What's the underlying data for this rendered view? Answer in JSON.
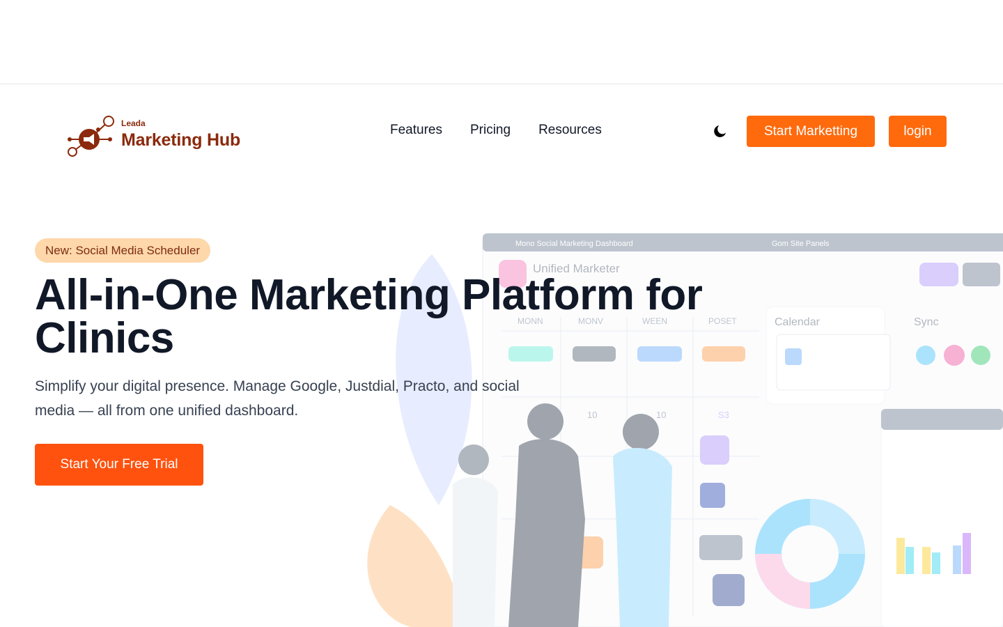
{
  "brand": {
    "small_label": "Leada",
    "name": "Marketing Hub",
    "color": "#8b2a0c"
  },
  "nav": {
    "items": [
      {
        "label": "Features"
      },
      {
        "label": "Pricing"
      },
      {
        "label": "Resources"
      }
    ]
  },
  "header_actions": {
    "theme_icon": "moon-icon",
    "start_label": "Start Marketting",
    "login_label": "login",
    "accent_color": "#ff6a0d"
  },
  "hero": {
    "badge": "New: Social Media Scheduler",
    "title": "All-in-One Marketing Platform for Clinics",
    "subtitle": "Simplify your digital presence. Manage Google, Justdial, Practo, and social media — all from one unified dashboard.",
    "cta_label": "Start Your Free Trial",
    "cta_color": "#ff520e"
  },
  "illustration": {
    "dashboard_title": "Unified Marketer",
    "calendar_label": "Calendar",
    "sync_label": "Sync",
    "days": [
      "MONN",
      "MONV",
      "WEEN",
      "POSET"
    ],
    "day_numbers": [
      "10",
      "10",
      "S3"
    ],
    "icons": [
      "instagram-icon",
      "facebook-icon",
      "linkedin-icon",
      "google-icon"
    ]
  }
}
